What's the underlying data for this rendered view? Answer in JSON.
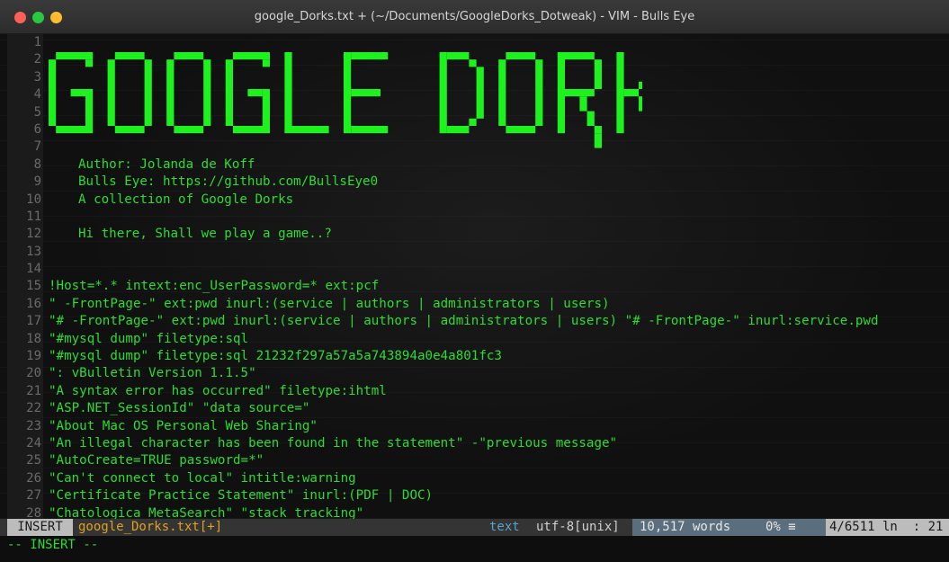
{
  "window": {
    "title": "google_Dorks.txt + (~/Documents/GoogleDorks_Dotweak) - VIM - Bulls Eye"
  },
  "editor": {
    "line_numbers": [
      "1",
      "2",
      "3",
      "4",
      "5",
      "6",
      "7",
      "8",
      "9",
      "10",
      "11",
      "12",
      "13",
      "14",
      "15",
      "16",
      "17",
      "18",
      "19",
      "20",
      "21",
      "22",
      "23",
      "24",
      "25",
      "26",
      "27",
      "28"
    ],
    "banner_text": "GOOGLE DORKS",
    "lines": [
      {
        "text": "",
        "indent": false
      },
      {
        "text": "",
        "indent": false
      },
      {
        "text": "",
        "indent": false
      },
      {
        "text": "",
        "indent": false
      },
      {
        "text": "",
        "indent": false
      },
      {
        "text": "",
        "indent": false
      },
      {
        "text": "",
        "indent": false
      },
      {
        "text": "Author: Jolanda de Koff",
        "indent": true
      },
      {
        "text": "Bulls Eye: https://github.com/BullsEye0",
        "indent": true
      },
      {
        "text": "A collection of Google Dorks",
        "indent": true
      },
      {
        "text": "",
        "indent": false
      },
      {
        "text": "Hi there, Shall we play a game..?",
        "indent": true
      },
      {
        "text": "",
        "indent": false
      },
      {
        "text": "",
        "indent": false
      },
      {
        "text": "!Host=*.* intext:enc_UserPassword=* ext:pcf",
        "indent": false
      },
      {
        "text": "\" -FrontPage-\" ext:pwd inurl:(service | authors | administrators | users)",
        "indent": false
      },
      {
        "text": "\"# -FrontPage-\" ext:pwd inurl:(service | authors | administrators | users) \"# -FrontPage-\" inurl:service.pwd",
        "indent": false
      },
      {
        "text": "\"#mysql dump\" filetype:sql",
        "indent": false
      },
      {
        "text": "\"#mysql dump\" filetype:sql 21232f297a57a5a743894a0e4a801fc3",
        "indent": false
      },
      {
        "text": "\": vBulletin Version 1.1.5\"",
        "indent": false
      },
      {
        "text": "\"A syntax error has occurred\" filetype:ihtml",
        "indent": false
      },
      {
        "text": "\"ASP.NET_SessionId\" \"data source=\"",
        "indent": false
      },
      {
        "text": "\"About Mac OS Personal Web Sharing\"",
        "indent": false
      },
      {
        "text": "\"An illegal character has been found in the statement\" -\"previous message\"",
        "indent": false
      },
      {
        "text": "\"AutoCreate=TRUE password=*\"",
        "indent": false
      },
      {
        "text": "\"Can't connect to local\" intitle:warning",
        "indent": false
      },
      {
        "text": "\"Certificate Practice Statement\" inurl:(PDF | DOC)",
        "indent": false
      },
      {
        "text": "\"Chatologica MetaSearch\" \"stack tracking\"",
        "indent": false
      }
    ]
  },
  "statusline": {
    "mode": "INSERT",
    "filename": "google_Dorks.txt[+]",
    "filetype": "text",
    "encoding": "utf-8[unix]",
    "words": "10,517 words",
    "percent": "0% ≡",
    "position": "4/6511 ln  : 21"
  },
  "cmdline": {
    "text": "-- INSERT --"
  },
  "colors": {
    "text_green": "#2bdc32",
    "banner_green": "#1ef21e",
    "filename_orange": "#e0a020"
  }
}
